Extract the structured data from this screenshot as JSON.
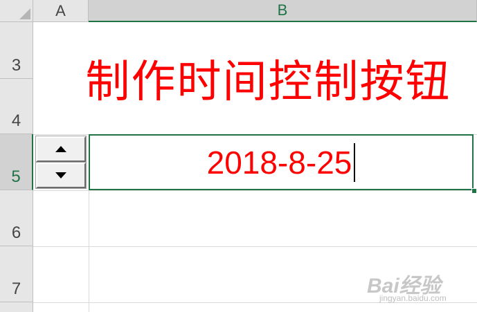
{
  "headers": {
    "columns": [
      "A",
      "B"
    ],
    "rows": [
      "3",
      "4",
      "5",
      "6",
      "7"
    ]
  },
  "cells": {
    "title": "制作时间控制按钮",
    "b5_value": "2018-8-25"
  },
  "spin_button": {
    "up_icon": "triangle-up-icon",
    "down_icon": "triangle-down-icon"
  },
  "watermark": {
    "logo_text": "Bai经验",
    "sub_text": "jingyan.baidu.com"
  },
  "colors": {
    "accent": "#217346",
    "title_text": "#ff0000",
    "value_text": "#ff0000",
    "header_bg": "#e6e6e6",
    "header_selected_bg": "#d2d2d2"
  }
}
